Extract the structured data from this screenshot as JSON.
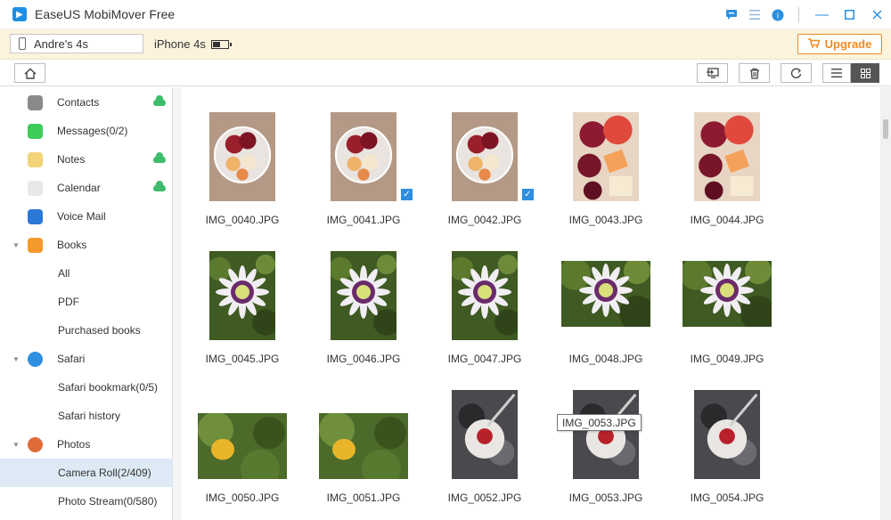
{
  "window": {
    "title": "EaseUS MobiMover Free"
  },
  "device": {
    "name": "Andre's 4s",
    "model": "iPhone 4s",
    "battery_level": 0.55,
    "upgrade_label": "Upgrade"
  },
  "sidebar": {
    "items": [
      {
        "label": "Contacts",
        "icon": "contacts-icon",
        "color": "#8a8a8a",
        "cloud": true,
        "level": 0
      },
      {
        "label": "Messages(0/2)",
        "icon": "messages-icon",
        "color": "#3dcb5a",
        "cloud": false,
        "level": 0
      },
      {
        "label": "Notes",
        "icon": "notes-icon",
        "color": "#f2d37a",
        "cloud": true,
        "level": 0
      },
      {
        "label": "Calendar",
        "icon": "calendar-icon",
        "color": "#e8e8e8",
        "cloud": true,
        "level": 0
      },
      {
        "label": "Voice Mail",
        "icon": "voicemail-icon",
        "color": "#2b78d6",
        "cloud": false,
        "level": 0
      },
      {
        "label": "Books",
        "icon": "books-icon",
        "color": "#f39a2b",
        "cloud": false,
        "level": 0,
        "expanded": true
      },
      {
        "label": "All",
        "level": 1
      },
      {
        "label": "PDF",
        "level": 1
      },
      {
        "label": "Purchased books",
        "level": 1
      },
      {
        "label": "Safari",
        "icon": "safari-icon",
        "color": "#2e8ee0",
        "cloud": false,
        "level": 0,
        "expanded": true
      },
      {
        "label": "Safari bookmark(0/5)",
        "level": 1
      },
      {
        "label": "Safari history",
        "level": 1
      },
      {
        "label": "Photos",
        "icon": "photos-icon",
        "color": "#e06b3a",
        "cloud": false,
        "level": 0,
        "expanded": true
      },
      {
        "label": "Camera Roll(2/409)",
        "level": 1,
        "selected": true
      },
      {
        "label": "Photo Stream(0/580)",
        "level": 1
      }
    ]
  },
  "photos": [
    {
      "name": "IMG_0040.JPG",
      "kind": "bowl",
      "checked": false
    },
    {
      "name": "IMG_0041.JPG",
      "kind": "bowl",
      "checked": true
    },
    {
      "name": "IMG_0042.JPG",
      "kind": "bowl",
      "checked": true
    },
    {
      "name": "IMG_0043.JPG",
      "kind": "fruit",
      "checked": false
    },
    {
      "name": "IMG_0044.JPG",
      "kind": "fruit",
      "checked": false
    },
    {
      "name": "IMG_0045.JPG",
      "kind": "flower",
      "checked": false
    },
    {
      "name": "IMG_0046.JPG",
      "kind": "flower",
      "checked": false
    },
    {
      "name": "IMG_0047.JPG",
      "kind": "flower",
      "checked": false
    },
    {
      "name": "IMG_0048.JPG",
      "kind": "flower-wide",
      "checked": false
    },
    {
      "name": "IMG_0049.JPG",
      "kind": "flower-wide",
      "checked": false
    },
    {
      "name": "IMG_0050.JPG",
      "kind": "lemon",
      "checked": false
    },
    {
      "name": "IMG_0051.JPG",
      "kind": "lemon",
      "checked": false
    },
    {
      "name": "IMG_0052.JPG",
      "kind": "dessert",
      "checked": false
    },
    {
      "name": "IMG_0053.JPG",
      "kind": "dessert",
      "checked": false
    },
    {
      "name": "IMG_0054.JPG",
      "kind": "dessert",
      "checked": false
    }
  ],
  "tooltip": {
    "text": "IMG_0053.JPG"
  },
  "colors": {
    "accent": "#2e8ee0",
    "upgrade": "#f08a24",
    "device_bar": "#fbf3dc",
    "selected_row": "#dde9f5"
  }
}
